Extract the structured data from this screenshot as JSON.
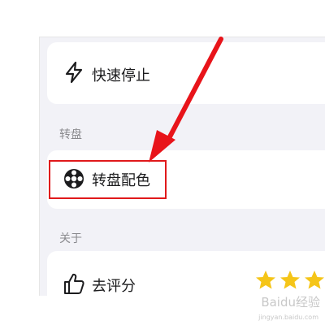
{
  "settings": {
    "quick_stop": {
      "label": "快速停止",
      "icon": "lightning-icon"
    },
    "wheel_section_title": "转盘",
    "wheel_colors": {
      "label": "转盘配色",
      "icon": "wheel-icon"
    },
    "about_section_title": "关于",
    "rate": {
      "label": "去评分",
      "icon": "thumbs-up-icon",
      "stars": 3
    }
  },
  "annotation": {
    "arrow_color": "#e8141a",
    "box_color": "#e0191b"
  },
  "watermark": {
    "text": "Baidu经验",
    "sub": "jingyan.baidu.com"
  }
}
